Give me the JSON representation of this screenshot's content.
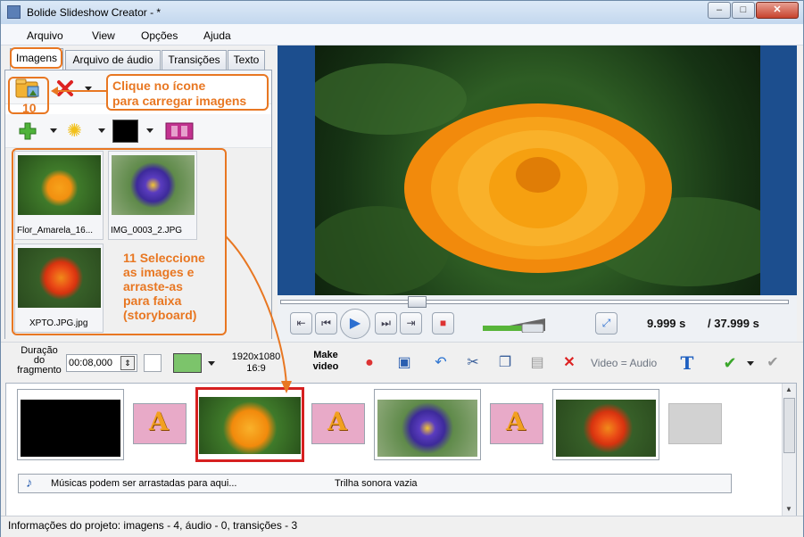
{
  "window": {
    "title": "Bolide Slideshow Creator - *"
  },
  "menu": [
    "Arquivo",
    "View",
    "Opções",
    "Ajuda"
  ],
  "tabs": [
    "Imagens",
    "Arquivo de áudio",
    "Transições",
    "Texto"
  ],
  "thumbnails": [
    {
      "name": "Flor_Amarela_16...",
      "kind": "yellow"
    },
    {
      "name": "IMG_0003_2.JPG",
      "kind": "purple"
    },
    {
      "name": "XPTO.JPG.jpg",
      "kind": "red"
    }
  ],
  "annotations": {
    "load_hint_line1": "Clique no ícone",
    "load_hint_line2": "para carregar imagens",
    "step10": "10",
    "step11_lines": [
      "11 Seleccione",
      "as images e",
      "arraste-as",
      "para faixa",
      "(storyboard)"
    ]
  },
  "player": {
    "current_time": "9.999 s",
    "total_time": "/ 37.999 s",
    "progress_fraction": 0.26,
    "volume_fraction": 0.65
  },
  "toolbar": {
    "duration_label_lines": [
      "Duração",
      "do",
      "fragmento"
    ],
    "duration_value": "00:08,000",
    "resolution_line1": "1920x1080",
    "resolution_line2": "16:9",
    "make_video_line1": "Make",
    "make_video_line2": "video",
    "video_audio_label": "Video = Audio"
  },
  "storyboard": {
    "music_placeholder": "Músicas podem ser arrastadas para aqui...",
    "soundtrack_status": "Trilha sonora vazia",
    "transition_letter": "A"
  },
  "status": "Informações do projeto: imagens - 4, áudio - 0, transições - 3",
  "colors": {
    "annotation": "#e87722",
    "selection": "#d62020",
    "preview_frame": "#1c4e8e"
  },
  "icons": [
    "open-folder-icon",
    "delete-icon",
    "add-icon",
    "sparkle-icon",
    "color-swatch-icon",
    "filmstrip-icon",
    "record-icon",
    "save-icon",
    "undo-icon",
    "cut-icon",
    "copy-icon",
    "paste-icon",
    "close-icon",
    "text-icon",
    "check-icon",
    "tools-icon",
    "note-icon"
  ]
}
